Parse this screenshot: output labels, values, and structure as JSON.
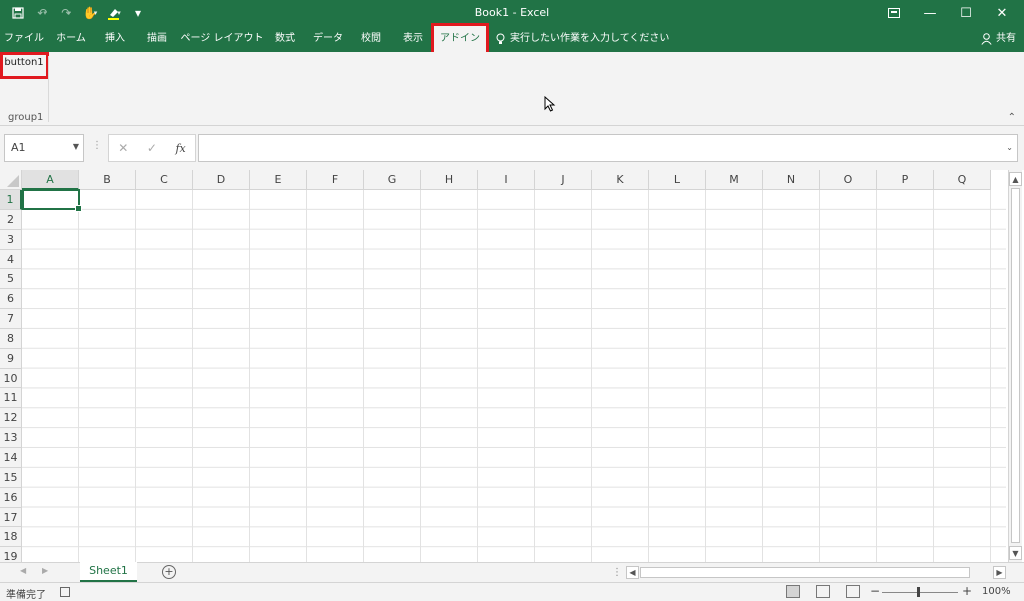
{
  "window": {
    "title": "Book1  -  Excel"
  },
  "quick_access": {
    "icons": [
      "save-icon",
      "undo-icon",
      "redo-icon",
      "touch-mode-icon",
      "highlight-icon",
      "customize-icon"
    ]
  },
  "tabs": [
    {
      "label": "ファイル"
    },
    {
      "label": "ホーム"
    },
    {
      "label": "挿入"
    },
    {
      "label": "描画"
    },
    {
      "label": "ページ レイアウト"
    },
    {
      "label": "数式"
    },
    {
      "label": "データ"
    },
    {
      "label": "校閲"
    },
    {
      "label": "表示"
    },
    {
      "label": "アドイン",
      "active": true
    }
  ],
  "tell_me": {
    "placeholder": "実行したい作業を入力してください"
  },
  "share": {
    "label": "共有"
  },
  "ribbon": {
    "button1": "button1",
    "group1": "group1"
  },
  "formula_bar": {
    "name_box": "A1",
    "fx": "fx",
    "value": ""
  },
  "grid": {
    "columns": [
      "A",
      "B",
      "C",
      "D",
      "E",
      "F",
      "G",
      "H",
      "I",
      "J",
      "K",
      "L",
      "M",
      "N",
      "O",
      "P",
      "Q"
    ],
    "rows": [
      "1",
      "2",
      "3",
      "4",
      "5",
      "6",
      "7",
      "8",
      "9",
      "10",
      "11",
      "12",
      "13",
      "14",
      "15",
      "16",
      "17",
      "18",
      "19"
    ],
    "active_cell": "A1"
  },
  "sheets": [
    {
      "name": "Sheet1",
      "active": true
    }
  ],
  "status": {
    "text": "準備完了",
    "zoom": "100%"
  },
  "colors": {
    "accent": "#217346",
    "highlight": "#e0191f"
  }
}
